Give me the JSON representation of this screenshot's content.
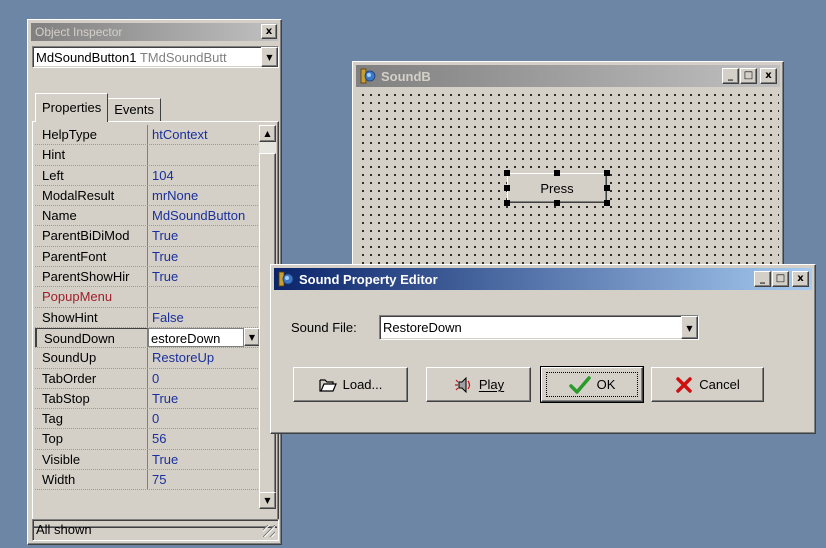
{
  "colors": {
    "desktop": "#6e86a6",
    "active_title_start": "#0a246a",
    "active_title_end": "#a6caf0",
    "inactive_title": "#808080",
    "value_text": "#1a2f9c",
    "event_text": "#a0202a",
    "ok_check": "#2a9a2a",
    "cancel_x": "#d01010"
  },
  "inspector": {
    "title": "Object Inspector",
    "close_label": "x",
    "component_name": "MdSoundButton1",
    "component_type": "TMdSoundButt",
    "tabs": [
      {
        "label": "Properties"
      },
      {
        "label": "Events"
      }
    ],
    "properties": [
      {
        "name": "HelpType",
        "value": "htContext"
      },
      {
        "name": "Hint",
        "value": ""
      },
      {
        "name": "Left",
        "value": "104"
      },
      {
        "name": "ModalResult",
        "value": "mrNone"
      },
      {
        "name": "Name",
        "value": "MdSoundButton"
      },
      {
        "name": "ParentBiDiMod",
        "value": "True"
      },
      {
        "name": "ParentFont",
        "value": "True"
      },
      {
        "name": "ParentShowHir",
        "value": "True"
      },
      {
        "name": "PopupMenu",
        "value": ""
      },
      {
        "name": "ShowHint",
        "value": "False"
      },
      {
        "name": "SoundDown",
        "value": "estoreDown"
      },
      {
        "name": "SoundUp",
        "value": "RestoreUp"
      },
      {
        "name": "TabOrder",
        "value": "0"
      },
      {
        "name": "TabStop",
        "value": "True"
      },
      {
        "name": "Tag",
        "value": "0"
      },
      {
        "name": "Top",
        "value": "56"
      },
      {
        "name": "Visible",
        "value": "True"
      },
      {
        "name": "Width",
        "value": "75"
      }
    ],
    "selected_property": "SoundDown",
    "status": "All shown"
  },
  "form": {
    "title": "SoundB",
    "minimize_label": "_",
    "maximize_label": "□",
    "close_label": "x",
    "button_caption": "Press"
  },
  "editor": {
    "title": "Sound Property Editor",
    "minimize_label": "_",
    "maximize_label": "□",
    "close_label": "x",
    "sound_file_label": "Sound File:",
    "sound_file_value": "RestoreDown",
    "buttons": {
      "load": "Load...",
      "play": "Play",
      "ok": "OK",
      "cancel": "Cancel"
    }
  }
}
